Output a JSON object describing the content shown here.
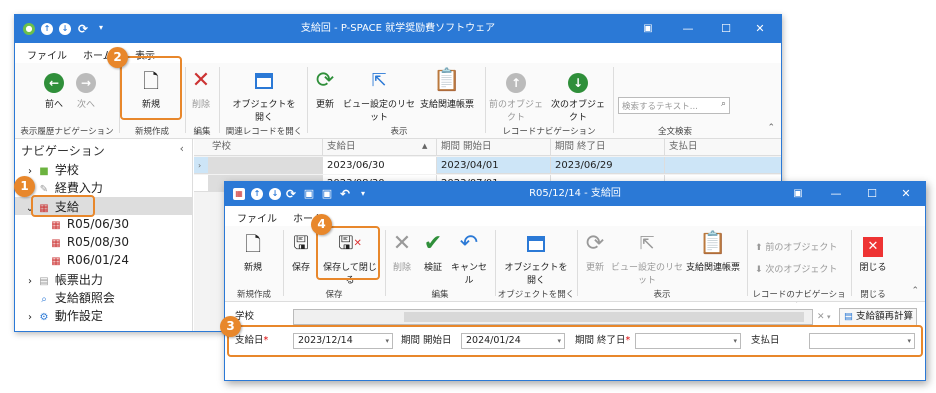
{
  "win1": {
    "title": "支給回 - P-SPACE 就学奨励費ソフトウェア",
    "tabs": [
      "ファイル",
      "ホーム",
      "表示"
    ],
    "ribbon": {
      "back": "前へ",
      "forward": "次へ",
      "new": "新規",
      "delete": "削除",
      "open_object": "オブジェクトを開く",
      "refresh": "更新",
      "view_reset": "ビュー設定のリセット",
      "report": "支給関連帳票",
      "prev_object": "前のオブジェクト",
      "next_object": "次のオブジェクト",
      "search_placeholder": "検索するテキスト...",
      "groups": [
        "表示履歴ナビゲーション",
        "新規作成",
        "編集",
        "関連レコードを開く",
        "表示",
        "レコードナビゲーション",
        "全文検索"
      ]
    },
    "nav": {
      "title": "ナビゲーション",
      "items": [
        "学校",
        "経費入力",
        "支給",
        "R05/06/30",
        "R05/08/30",
        "R06/01/24",
        "帳票出力",
        "支給額照会",
        "動作設定"
      ]
    },
    "grid": {
      "columns": [
        "学校",
        "支給日",
        "期間 開始日",
        "期間 終了日",
        "支払日"
      ],
      "rows": [
        [
          "",
          "2023/06/30",
          "2023/04/01",
          "2023/06/29",
          ""
        ],
        [
          "",
          "2023/08/30",
          "2023/07/01",
          "",
          ""
        ]
      ]
    }
  },
  "win2": {
    "title": "R05/12/14 - 支給回",
    "tabs": [
      "ファイル",
      "ホーム"
    ],
    "ribbon": {
      "new": "新規",
      "save": "保存",
      "save_close": "保存して閉じる",
      "delete": "削除",
      "verify": "検証",
      "cancel": "キャンセル",
      "open_object": "オブジェクトを開く",
      "refresh": "更新",
      "view_reset": "ビュー設定のリセット",
      "report": "支給関連帳票",
      "prev_object": "前のオブジェクト",
      "next_object": "次のオブジェクト",
      "close": "閉じる",
      "groups": [
        "新規作成",
        "保存",
        "編集",
        "オブジェクトを開く",
        "表示",
        "レコードのナビゲーション",
        "閉じる"
      ]
    },
    "form": {
      "school_label": "学校",
      "recalc_button": "支給額再計算",
      "pay_date_label": "支給日",
      "pay_date_value": "2023/12/14",
      "start_label": "期間 開始日",
      "start_value": "2024/01/24",
      "end_label": "期間 終了日",
      "end_value": "",
      "paid_label": "支払日",
      "paid_value": ""
    }
  },
  "callouts": [
    "1",
    "2",
    "3",
    "4"
  ],
  "colors": {
    "accent": "#2b79d6",
    "callout": "#e8872b",
    "selected_row": "#cde5f7"
  }
}
